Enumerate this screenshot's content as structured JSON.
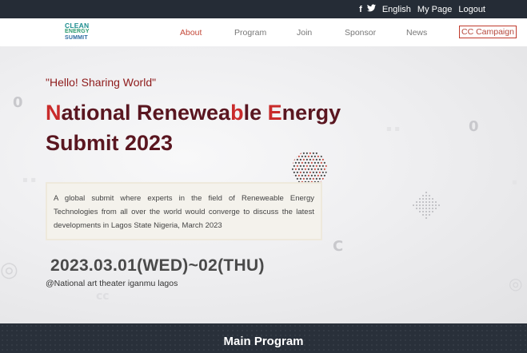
{
  "topbar": {
    "icons": [
      "facebook-icon",
      "twitter-icon"
    ],
    "links": [
      "English",
      "My Page",
      "Logout"
    ]
  },
  "logo": {
    "lines": [
      "CLEAN",
      "ENERGY",
      "SUMMIT"
    ]
  },
  "nav": {
    "items": [
      "About",
      "Program",
      "Join",
      "Sponsor",
      "News",
      "CC Campaign"
    ],
    "active": "About"
  },
  "hero": {
    "tagline": "\"Hello! Sharing World\"",
    "title_parts": [
      {
        "text": "N",
        "highlight": true
      },
      {
        "text": "ational Renewea",
        "highlight": false
      },
      {
        "text": "b",
        "highlight": true
      },
      {
        "text": "le ",
        "highlight": false
      },
      {
        "text": "E",
        "highlight": true
      },
      {
        "text": "nergy Submit 2023",
        "highlight": false
      }
    ],
    "description": "A global submit where experts in the field of Reneweable Energy Technologies from all over the world would converge to discuss the latest developments in Lagos State Nigeria, March 2023",
    "date": "2023.03.01(WED)~02(THU)",
    "venue": "@National art theater iganmu lagos"
  },
  "section": {
    "title": "Main Program"
  },
  "colors": {
    "accent": "#c92b2b",
    "dark_title": "#5a1620",
    "topbar": "#252c36"
  }
}
